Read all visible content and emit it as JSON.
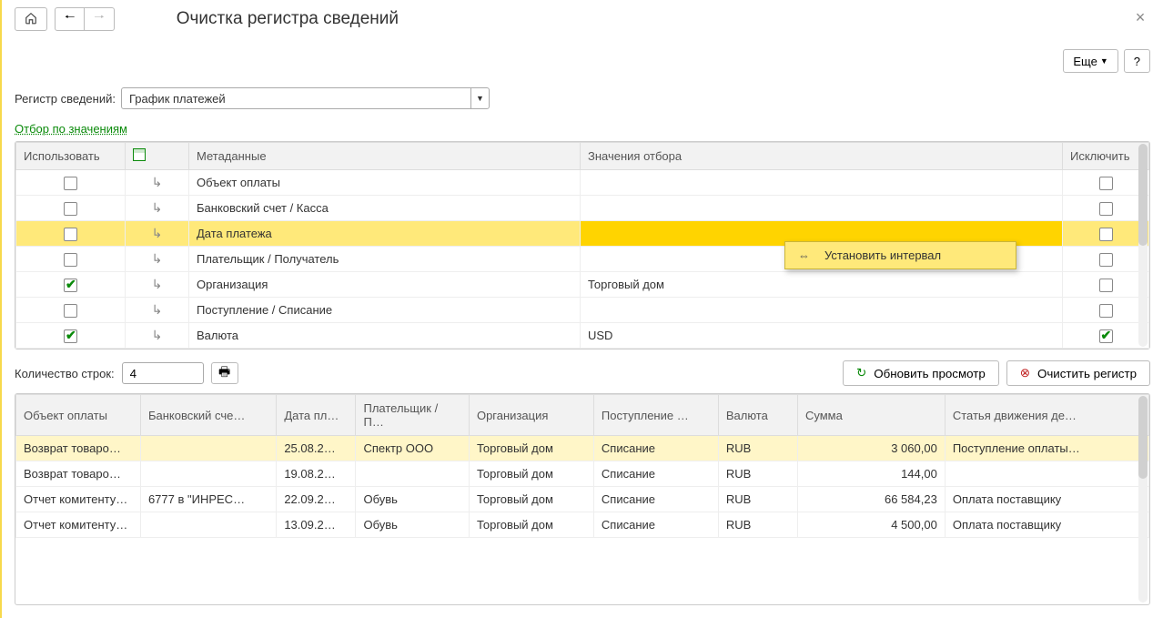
{
  "header": {
    "title": "Очистка регистра сведений",
    "more_label": "Еще",
    "help_label": "?"
  },
  "register": {
    "label": "Регистр сведений:",
    "value": "График платежей"
  },
  "filter_link": "Отбор по значениям",
  "filter_table": {
    "headers": {
      "use": "Использовать",
      "meta": "Метаданные",
      "values": "Значения отбора",
      "excl": "Исключить"
    },
    "rows": [
      {
        "use": false,
        "meta": "Объект оплаты",
        "val": "",
        "excl": false,
        "selected": false
      },
      {
        "use": false,
        "meta": "Банковский счет / Касса",
        "val": "",
        "excl": false,
        "selected": false
      },
      {
        "use": false,
        "meta": "Дата платежа",
        "val": "",
        "excl": false,
        "selected": true
      },
      {
        "use": false,
        "meta": "Плательщик / Получатель",
        "val": "",
        "excl": false,
        "selected": false
      },
      {
        "use": true,
        "meta": "Организация",
        "val": "Торговый дом",
        "excl": false,
        "selected": false
      },
      {
        "use": false,
        "meta": "Поступление / Списание",
        "val": "",
        "excl": false,
        "selected": false
      },
      {
        "use": true,
        "meta": "Валюта",
        "val": "USD",
        "excl": true,
        "selected": false
      }
    ]
  },
  "context_menu": {
    "set_interval": "Установить интервал"
  },
  "row_count": {
    "label": "Количество строк:",
    "value": "4"
  },
  "actions": {
    "refresh": "Обновить просмотр",
    "clear": "Очистить регистр"
  },
  "preview": {
    "headers": [
      "Объект оплаты",
      "Банковский сче…",
      "Дата пл…",
      "Плательщик / П…",
      "Организация",
      "Поступление …",
      "Валюта",
      "Сумма",
      "Статья движения де…"
    ],
    "rows": [
      {
        "hl": true,
        "c": [
          "Возврат товаро…",
          "",
          "25.08.2…",
          "Спектр ООО",
          "Торговый дом",
          "Списание",
          "RUB",
          "3 060,00",
          "Поступление оплаты…"
        ]
      },
      {
        "hl": false,
        "c": [
          "Возврат товаро…",
          "",
          "19.08.2…",
          "",
          "Торговый дом",
          "Списание",
          "RUB",
          "144,00",
          ""
        ]
      },
      {
        "hl": false,
        "c": [
          "Отчет комитенту…",
          "6777 в \"ИНРЕС…",
          "22.09.2…",
          "Обувь",
          "Торговый дом",
          "Списание",
          "RUB",
          "66 584,23",
          "Оплата поставщику"
        ]
      },
      {
        "hl": false,
        "c": [
          "Отчет комитенту…",
          "",
          "13.09.2…",
          "Обувь",
          "Торговый дом",
          "Списание",
          "RUB",
          "4 500,00",
          "Оплата поставщику"
        ]
      }
    ]
  }
}
